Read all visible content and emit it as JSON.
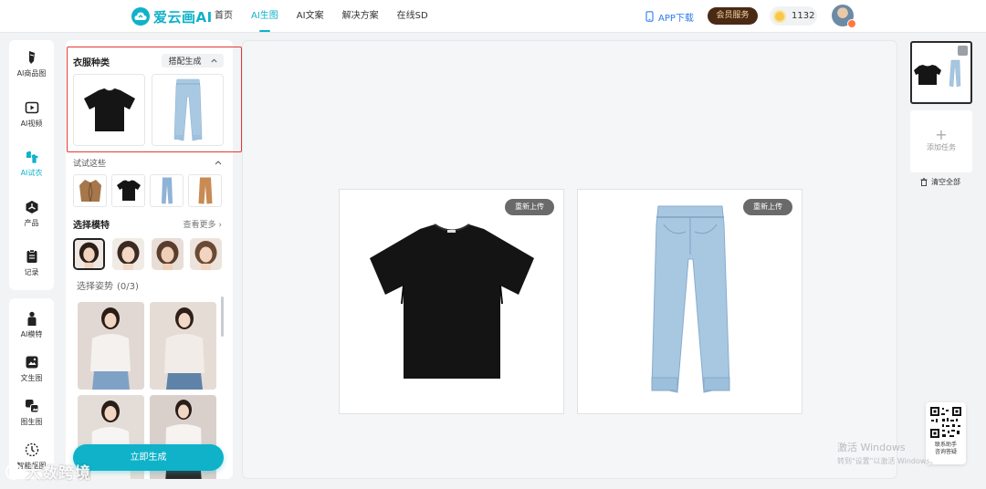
{
  "brand": {
    "name": "爱云画AI",
    "accent": "#0fb2c9"
  },
  "nav": {
    "items": [
      {
        "label": "首页",
        "active": false
      },
      {
        "label": "AI生图",
        "active": true
      },
      {
        "label": "AI文案",
        "active": false
      },
      {
        "label": "解决方案",
        "active": false
      },
      {
        "label": "在线SD",
        "active": false
      }
    ],
    "app_download": "APP下载",
    "vip": "会员服务",
    "coins": "1132"
  },
  "rail_top": [
    {
      "label": "AI商品图",
      "icon": "pen-icon"
    },
    {
      "label": "AI视频",
      "icon": "video-icon"
    },
    {
      "label": "AI试衣",
      "icon": "clothes-icon",
      "active": true
    },
    {
      "label": "产品",
      "icon": "cube-icon"
    },
    {
      "label": "记录",
      "icon": "clipboard-icon"
    }
  ],
  "rail_bottom": [
    {
      "label": "AI模特",
      "icon": "person-icon"
    },
    {
      "label": "文生图",
      "icon": "text-image-icon"
    },
    {
      "label": "图生图",
      "icon": "image-image-icon"
    },
    {
      "label": "智能抠图",
      "icon": "cutout-icon"
    }
  ],
  "panel": {
    "clothing_title": "衣服种类",
    "combo_label": "搭配生成",
    "try_these": "试试这些",
    "model_title": "选择模特",
    "see_more": "查看更多",
    "pose_title": "选择姿势",
    "pose_count": "(0/3)",
    "generate": "立即生成"
  },
  "canvas": {
    "reupload_label": "重新上传"
  },
  "right": {
    "add_task": "添加任务",
    "clear_all": "清空全部",
    "qr_line1": "联系助手",
    "qr_line2": "咨询答疑"
  },
  "overlay": {
    "win_line1": "激活 Windows",
    "win_line2": "转到\"设置\"以激活 Windows。",
    "watermark": "大数跨境"
  }
}
